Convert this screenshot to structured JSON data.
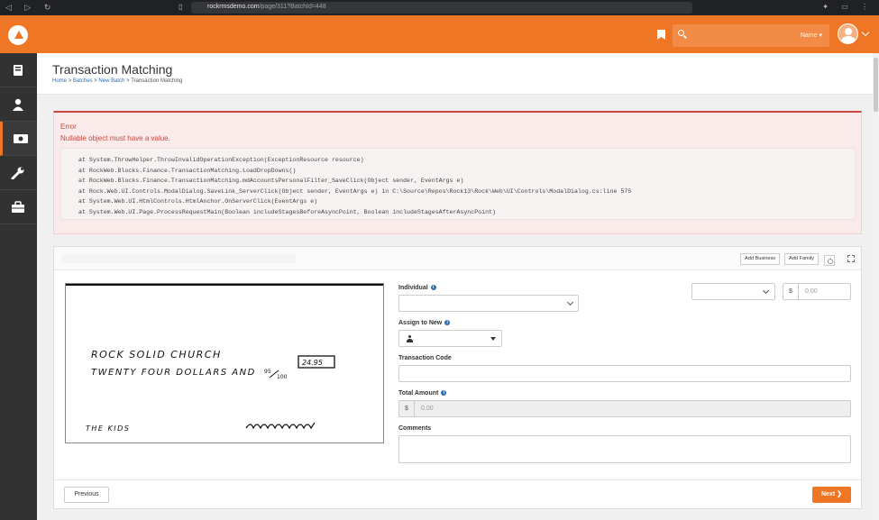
{
  "browser": {
    "url_host": "rockrmsdemo.com",
    "url_path": "/page/311?BatchId=448"
  },
  "topbar": {
    "search_scope": "Name",
    "search_placeholder": ""
  },
  "sidebar": {
    "items": [
      {
        "icon": "book-icon"
      },
      {
        "icon": "user-icon"
      },
      {
        "icon": "money-icon",
        "active": true
      },
      {
        "icon": "wrench-icon"
      },
      {
        "icon": "briefcase-icon"
      }
    ]
  },
  "page": {
    "title": "Transaction Matching",
    "breadcrumbs": [
      "Home",
      "Batches",
      "New Batch",
      "Transaction Matching"
    ],
    "breadcrumb_sep": ">"
  },
  "error": {
    "title": "Error",
    "message": "Nullable object must have a value.",
    "stack": [
      "at System.ThrowHelper.ThrowInvalidOperationException(ExceptionResource resource)",
      "at RockWeb.Blocks.Finance.TransactionMatching.LoadDropDowns()",
      "at RockWeb.Blocks.Finance.TransactionMatching.mdAccountsPersonalFilter_SaveClick(Object sender, EventArgs e)",
      "at Rock.Web.UI.Controls.ModalDialog.SaveLink_ServerClick(Object sender, EventArgs e) in C:\\Source\\Repos\\Rock13\\Rock\\Web\\UI\\Controls\\ModalDialog.cs:line 575",
      "at System.Web.UI.HtmlControls.HtmlAnchor.OnServerClick(EventArgs e)",
      "at System.Web.UI.Page.ProcessRequestMain(Boolean includeStagesBeforeAsyncPoint, Boolean includeStagesAfterAsyncPoint)"
    ]
  },
  "panel": {
    "add_business_label": "Add Business",
    "add_family_label": "Add Family",
    "check": {
      "payee": "Rock Solid Church",
      "amount_words": "Twenty Four Dollars and",
      "cents_num": "95",
      "cents_den": "100",
      "amount": "24.95",
      "memo": "The Kids"
    },
    "form": {
      "individual_label": "Individual",
      "individual_value": "",
      "assign_label": "Assign to New",
      "transaction_code_label": "Transaction Code",
      "transaction_code_value": "",
      "total_amount_label": "Total Amount",
      "currency_symbol": "$",
      "total_amount_placeholder": "0.00",
      "comments_label": "Comments",
      "comments_value": "",
      "account_select_value": "",
      "account_amount_placeholder": "0.00"
    },
    "previous_label": "Previous",
    "next_label": "Next",
    "next_icon": "chevron-right-icon"
  },
  "colors": {
    "brand": "#ee7625",
    "error": "#c9473c",
    "sidebar": "#323232",
    "link": "#2a6ebb"
  }
}
